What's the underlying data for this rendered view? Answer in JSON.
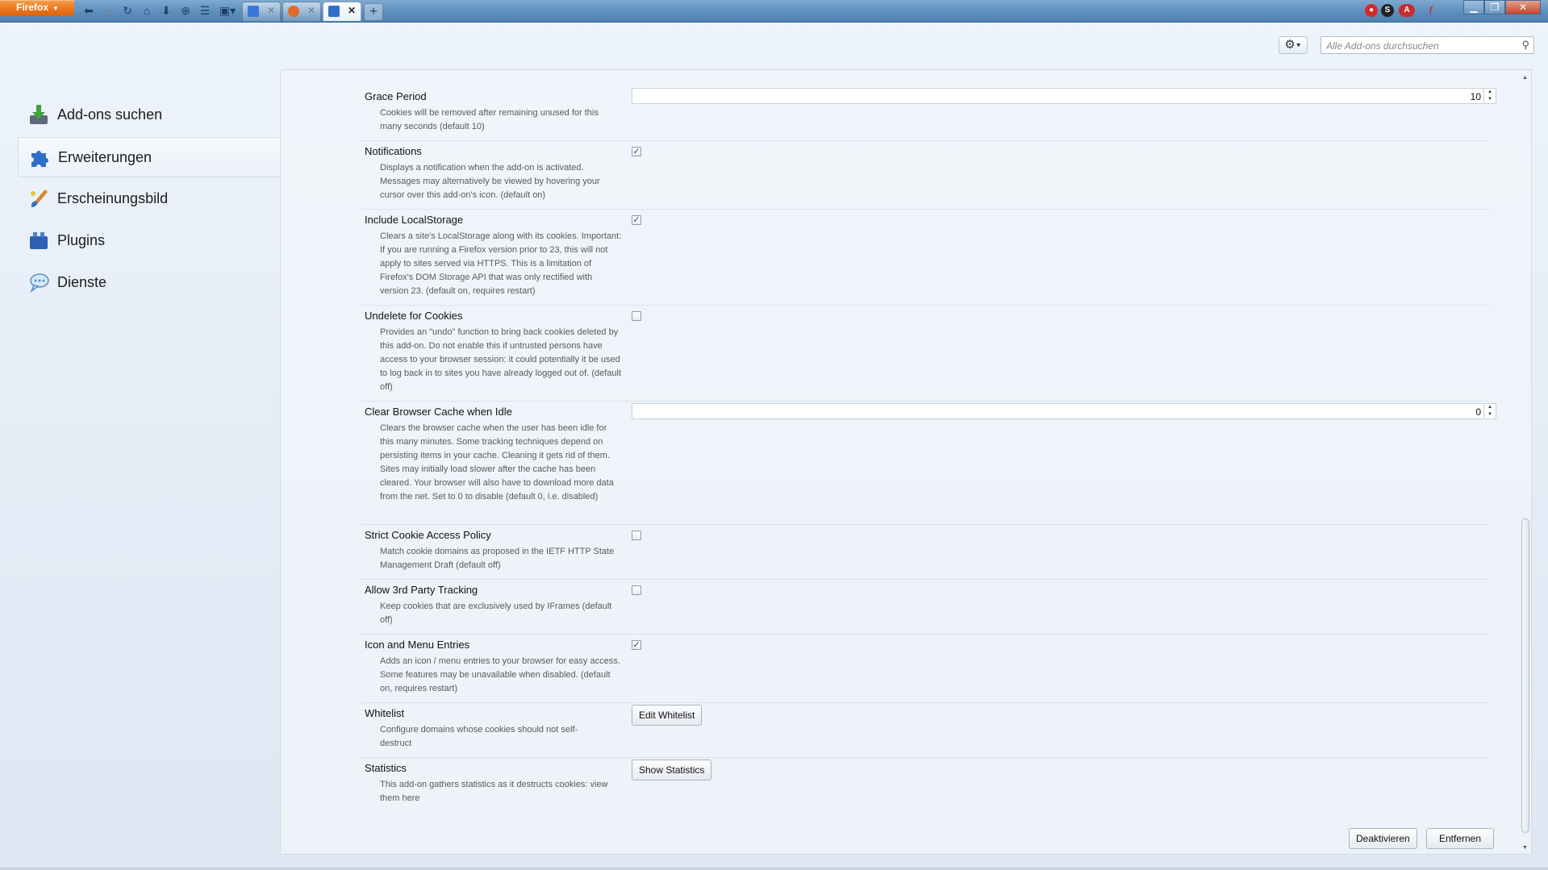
{
  "browser": {
    "menu_button": "Firefox",
    "tabs": [
      {
        "name": "google-tab",
        "icon": "google-icon",
        "color": "#3a77d8"
      },
      {
        "name": "history-tab",
        "icon": "history-icon",
        "color": "#e06a2c"
      },
      {
        "name": "addons-tab",
        "icon": "puzzle-icon",
        "color": "#2f6fc9",
        "active": true
      }
    ],
    "new_tab_label": "+"
  },
  "header": {
    "search_placeholder": "Alle Add-ons durchsuchen"
  },
  "sidebar": {
    "items": [
      {
        "label": "Add-ons suchen",
        "icon": "download-addons-icon"
      },
      {
        "label": "Erweiterungen",
        "icon": "puzzle-icon",
        "selected": true
      },
      {
        "label": "Erscheinungsbild",
        "icon": "paintbrush-icon"
      },
      {
        "label": "Plugins",
        "icon": "plugin-blocks-icon"
      },
      {
        "label": "Dienste",
        "icon": "chat-bubble-icon"
      }
    ]
  },
  "prefs": {
    "grace_period": {
      "title": "Grace Period",
      "desc": "Cookies will be removed after remaining unused for this many seconds (default 10)",
      "value": "10"
    },
    "notifications": {
      "title": "Notifications",
      "desc": "Displays a notification when the add-on is activated. Messages may alternatively be viewed by hovering your cursor over this add-on's icon. (default on)",
      "checked": true
    },
    "local_storage": {
      "title": "Include LocalStorage",
      "desc": "Clears a site's LocalStorage along with its cookies. Important: If you are running a Firefox version prior to 23, this will not apply to sites served via HTTPS. This is a limitation of Firefox's DOM Storage API that was only rectified with version 23. (default on, requires restart)",
      "checked": true
    },
    "undelete": {
      "title": "Undelete for Cookies",
      "desc": "Provides an \"undo\" function to bring back cookies deleted by this add-on. Do not enable this if untrusted persons have access to your browser session: it could potentially it be used to log back in to sites you have already logged out of. (default off)",
      "checked": false
    },
    "clear_cache": {
      "title": "Clear Browser Cache when Idle",
      "desc": "Clears the browser cache when the user has been idle for this many minutes. Some tracking techniques depend on persisting items in your cache. Cleaning it gets rid of them. Sites may initially load slower after the cache has been cleared. Your browser will also have to download more data from the net. Set to 0 to disable (default 0, i.e. disabled)",
      "value": "0"
    },
    "strict_policy": {
      "title": "Strict Cookie Access Policy",
      "desc": "Match cookie domains as proposed in the IETF HTTP State Management Draft (default off)",
      "checked": false
    },
    "third_party": {
      "title": "Allow 3rd Party Tracking",
      "desc": "Keep cookies that are exclusively used by IFrames (default off)",
      "checked": false
    },
    "icon_menu": {
      "title": "Icon and Menu Entries",
      "desc": "Adds an icon / menu entries to your browser for easy access. Some features may be unavailable when disabled. (default on, requires restart)",
      "checked": true
    },
    "whitelist": {
      "title": "Whitelist",
      "desc": "Configure domains whose cookies should not self-destruct",
      "button": "Edit Whitelist"
    },
    "statistics": {
      "title": "Statistics",
      "desc": "This add-on gathers statistics as it destructs cookies: view them here",
      "button": "Show Statistics"
    }
  },
  "footer": {
    "disable_label": "Deaktivieren",
    "remove_label": "Entfernen"
  }
}
